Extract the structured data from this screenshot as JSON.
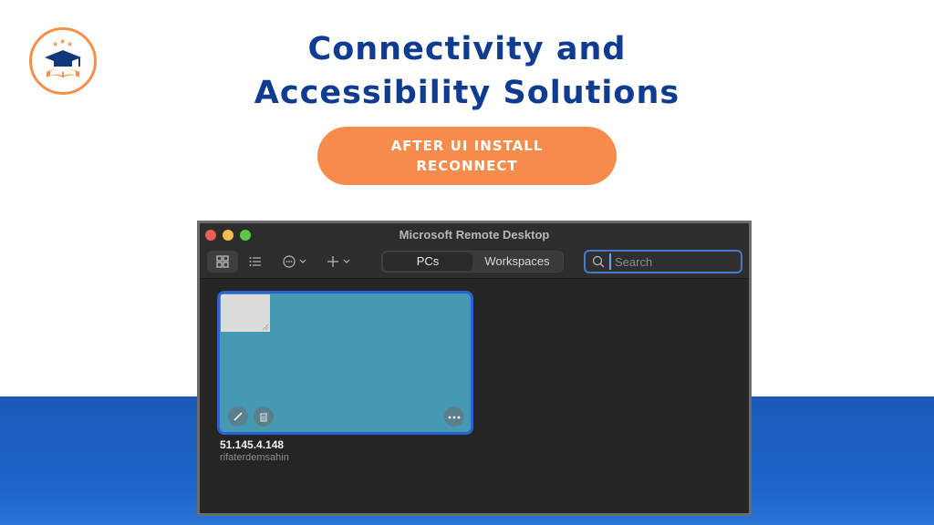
{
  "slide": {
    "title_line1": "Connectivity and",
    "title_line2": "Accessibility Solutions",
    "badge_line1": "AFTER UI INSTALL",
    "badge_line2": "RECONNECT"
  },
  "colors": {
    "title": "#0f3c91",
    "badge": "#f68c4b",
    "band": "#1d64c8",
    "card": "#4599b3",
    "selection": "#2a62d4"
  },
  "window": {
    "title": "Microsoft Remote Desktop",
    "toolbar": {
      "grid_icon": "grid-icon",
      "list_icon": "list-icon",
      "more_icon": "ellipsis-circle-icon",
      "add_icon": "plus-icon"
    },
    "tabs": [
      {
        "label": "PCs",
        "selected": true
      },
      {
        "label": "Workspaces",
        "selected": false
      }
    ],
    "search": {
      "placeholder": "Search",
      "value": ""
    },
    "pcs": [
      {
        "name": "51.145.4.148",
        "user": "rifaterdemsahin"
      }
    ]
  }
}
